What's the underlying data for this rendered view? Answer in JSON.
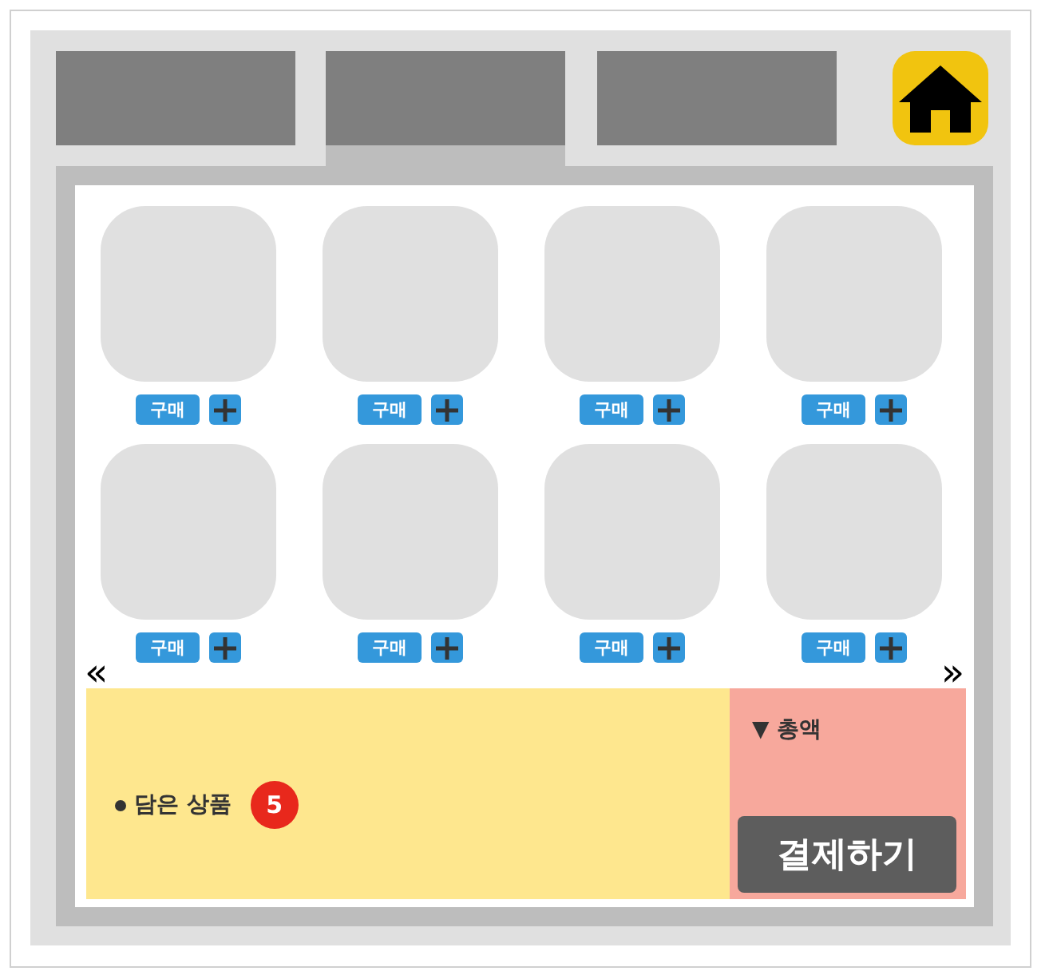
{
  "tabs": [
    {
      "selected": false
    },
    {
      "selected": true
    },
    {
      "selected": false
    }
  ],
  "products": [
    {
      "buy_label": "구매"
    },
    {
      "buy_label": "구매"
    },
    {
      "buy_label": "구매"
    },
    {
      "buy_label": "구매"
    },
    {
      "buy_label": "구매"
    },
    {
      "buy_label": "구매"
    },
    {
      "buy_label": "구매"
    },
    {
      "buy_label": "구매"
    }
  ],
  "pager": {
    "prev": "«",
    "next": "»"
  },
  "cart": {
    "label": "담은 상품",
    "count": "5"
  },
  "total": {
    "marker": "▼",
    "label": "총액"
  },
  "checkout_button": "결제하기"
}
